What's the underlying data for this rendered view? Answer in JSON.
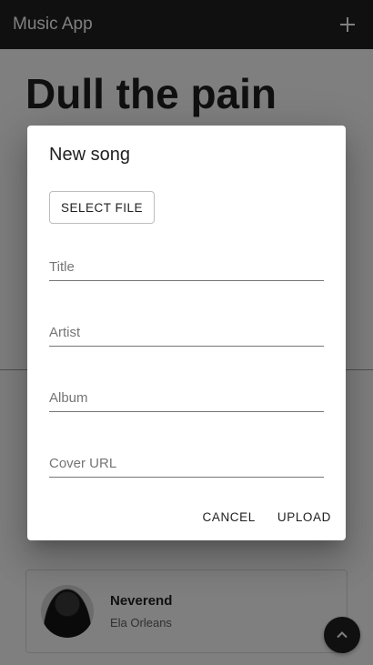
{
  "app": {
    "title": "Music App"
  },
  "header": {
    "add_icon": "plus-icon"
  },
  "main": {
    "song_title": "Dull the pain",
    "song_card": {
      "title": "Neverend",
      "artist": "Ela Orleans"
    },
    "scroll_top_icon": "chevron-up-icon"
  },
  "dialog": {
    "title": "New song",
    "select_file_label": "SELECT FILE",
    "fields": {
      "title": {
        "placeholder": "Title",
        "value": ""
      },
      "artist": {
        "placeholder": "Artist",
        "value": ""
      },
      "album": {
        "placeholder": "Album",
        "value": ""
      },
      "cover_url": {
        "placeholder": "Cover URL",
        "value": ""
      }
    },
    "cancel_label": "CANCEL",
    "upload_label": "UPLOAD"
  },
  "colors": {
    "appbar": "#212121",
    "scrim": "rgba(0,0,0,0.5)",
    "dialog_bg": "#ffffff"
  }
}
